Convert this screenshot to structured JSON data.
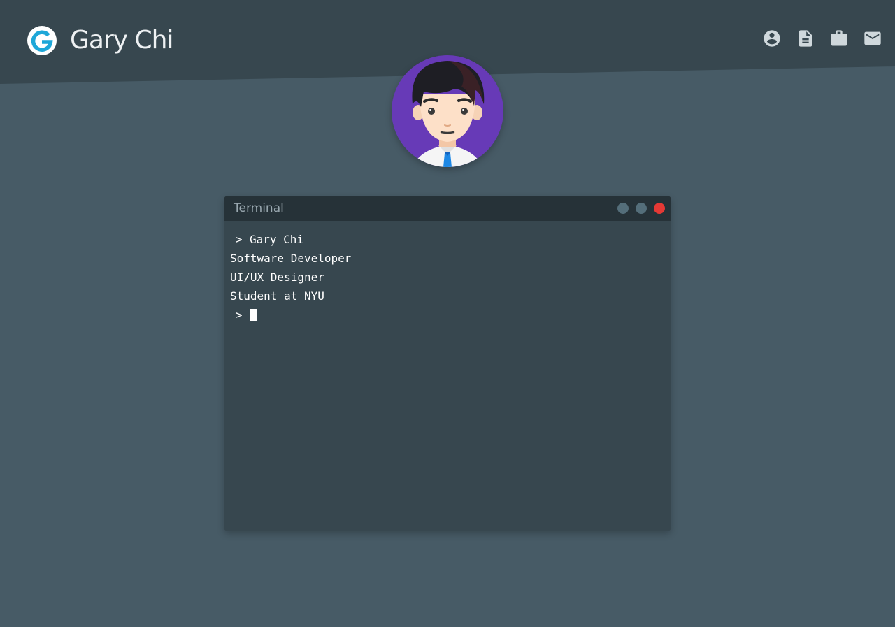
{
  "header": {
    "brand_name": "Gary Chi",
    "logo_icon": "g-logo-icon",
    "nav": [
      {
        "icon": "account-circle-icon"
      },
      {
        "icon": "document-icon"
      },
      {
        "icon": "briefcase-icon"
      },
      {
        "icon": "mail-icon"
      }
    ]
  },
  "avatar": {
    "icon": "cartoon-avatar"
  },
  "terminal": {
    "title": "Terminal",
    "prompt_symbol": ">",
    "command": "Gary Chi",
    "output": [
      "Software Developer",
      "UI/UX Designer",
      "Student at NYU"
    ]
  },
  "colors": {
    "background": "#475b66",
    "header": "#37474f",
    "terminal_body": "#37474f",
    "terminal_titlebar": "#263238",
    "dot_gray": "#546e7a",
    "dot_close": "#e53935",
    "avatar_bg": "#673ab7"
  }
}
